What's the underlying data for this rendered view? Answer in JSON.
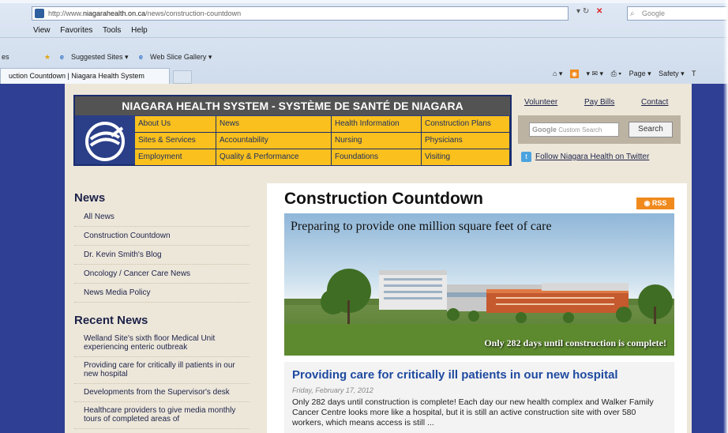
{
  "browser": {
    "address_prefix": "http://www.",
    "address_domain": "niagarahealth.on.ca",
    "address_path": "/news/construction-countdown",
    "search_placeholder": "Google",
    "menu": [
      "View",
      "Favorites",
      "Tools",
      "Help"
    ],
    "favorites_star_left": "es",
    "suggested_sites": "Suggested Sites ▾",
    "web_slice": "Web Slice Gallery ▾",
    "tab_title": "uction Countdown | Niagara Health System",
    "cmd_page": "Page ▾",
    "cmd_safety": "Safety ▾",
    "cmd_tools": "T"
  },
  "site": {
    "title": "NIAGARA HEALTH SYSTEM - SYSTÈME DE SANTÉ DE NIAGARA",
    "nav": [
      [
        "About Us",
        "News",
        "Health Information",
        "Construction Plans"
      ],
      [
        "Sites & Services",
        "Accountability",
        "Nursing",
        "Physicians"
      ],
      [
        "Employment",
        "Quality & Performance",
        "Foundations",
        "Visiting"
      ]
    ],
    "util": {
      "volunteer": "Volunteer",
      "pay_bills": "Pay Bills",
      "contact": "Contact"
    },
    "search": {
      "google_label": "Google",
      "placeholder": "Custom Search",
      "button": "Search"
    },
    "twitter": "Follow Niagara Health on Twitter"
  },
  "sidebar": {
    "news_heading": "News",
    "news_items": [
      "All News",
      "Construction Countdown",
      "Dr. Kevin Smith's Blog",
      "Oncology / Cancer Care News",
      "News Media Policy"
    ],
    "recent_heading": "Recent News",
    "recent_items": [
      "Welland Site's sixth floor Medical Unit experiencing enteric outbreak",
      "Providing care for critically ill patients in our new hospital",
      "Developments from the Supervisor's desk",
      "Healthcare providers to give media monthly tours of completed areas of"
    ]
  },
  "content": {
    "title": "Construction Countdown",
    "rss": "RSS",
    "hero_caption": "Preparing to provide one million square feet of care",
    "hero_countdown": "Only 282 days until construction is complete!",
    "article": {
      "title": "Providing care for critically ill patients in our new hospital",
      "date": "Friday, February 17, 2012",
      "body": "Only 282 days until construction is complete! Each day our new health complex and Walker Family Cancer Centre looks more like a hospital, but it is still an active construction site with over 580 workers, which means access is still ..."
    }
  }
}
